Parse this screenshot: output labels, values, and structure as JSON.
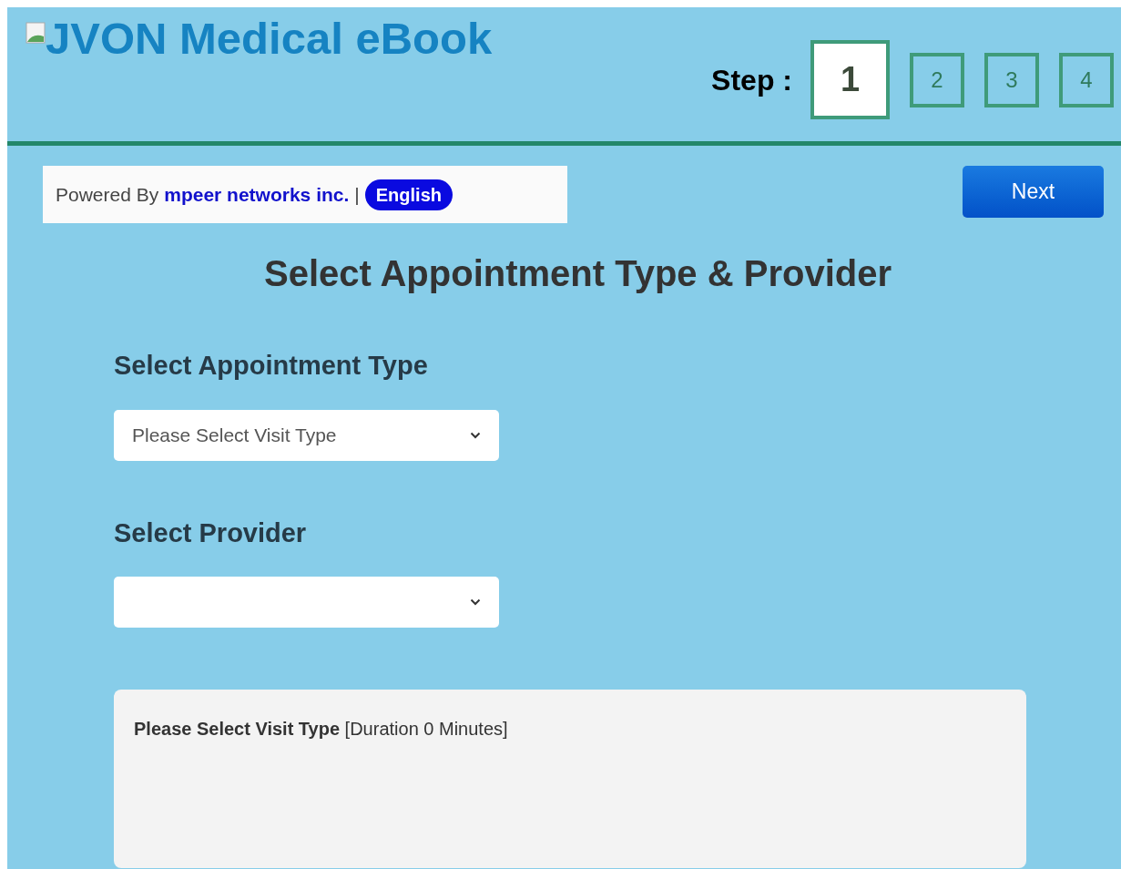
{
  "header": {
    "title": "JVON Medical eBook",
    "step_label": "Step :",
    "steps": [
      {
        "label": "1",
        "selected": true
      },
      {
        "label": "2",
        "selected": false
      },
      {
        "label": "3",
        "selected": false
      },
      {
        "label": "4",
        "selected": false
      }
    ]
  },
  "powered_by": {
    "prefix": "Powered By",
    "link": "mpeer networks inc.",
    "separator": "|",
    "language": "English"
  },
  "next_button": "Next",
  "heading": "Select Appointment Type & Provider",
  "fields": [
    {
      "label": "Select Appointment Type",
      "value": "Please Select Visit Type"
    },
    {
      "label": "Select Provider"
    }
  ],
  "info": "**Please Select Visit Type** [Duration 0 Minutes]"
}
